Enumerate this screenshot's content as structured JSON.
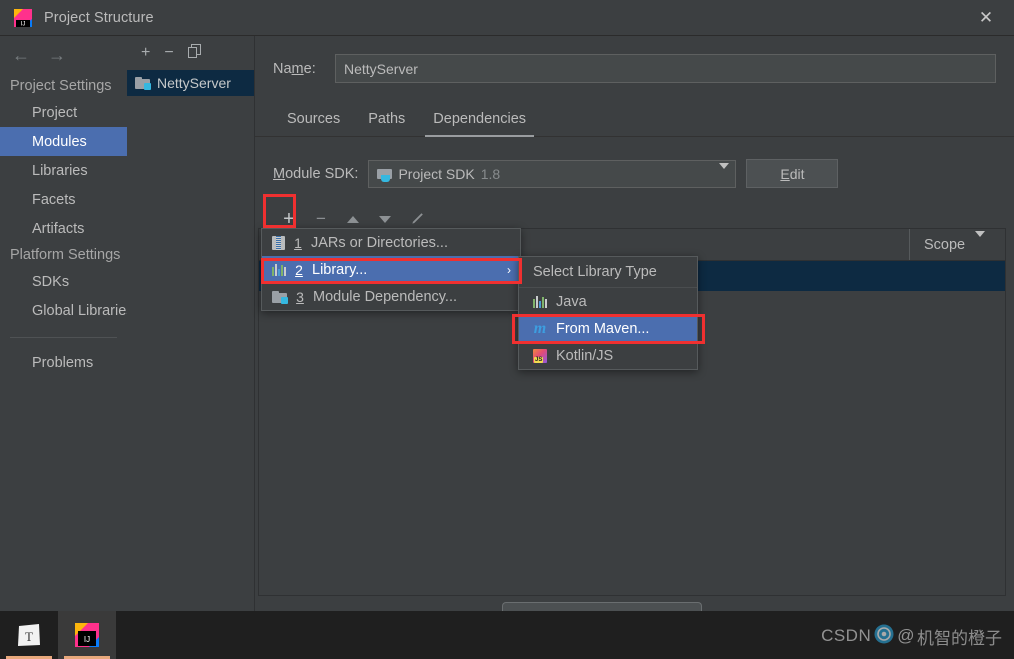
{
  "window": {
    "title": "Project Structure",
    "close_label": "✕",
    "app_icon": "intellij-idea-icon"
  },
  "leftnav": {
    "back_icon": "←",
    "forward_icon": "→",
    "groups": [
      {
        "label": "Project Settings",
        "items": [
          {
            "label": "Project",
            "selected": false
          },
          {
            "label": "Modules",
            "selected": true
          },
          {
            "label": "Libraries",
            "selected": false
          },
          {
            "label": "Facets",
            "selected": false
          },
          {
            "label": "Artifacts",
            "selected": false
          }
        ]
      },
      {
        "label": "Platform Settings",
        "items": [
          {
            "label": "SDKs",
            "selected": false
          },
          {
            "label": "Global Libraries",
            "selected": false
          }
        ]
      }
    ],
    "problems_label": "Problems"
  },
  "modules_panel": {
    "toolbar": {
      "add_icon": "+",
      "remove_icon": "−",
      "copy_icon": "copy-icon"
    },
    "modules": [
      {
        "name": "NettyServer",
        "selected": true
      }
    ]
  },
  "detail": {
    "name_label_pre": "Na",
    "name_label_mid": "m",
    "name_label_post": "e:",
    "name_value": "NettyServer",
    "tabs": [
      {
        "label": "Sources",
        "active": false
      },
      {
        "label": "Paths",
        "active": false
      },
      {
        "label": "Dependencies",
        "active": true
      }
    ],
    "sdk_label_pre": "M",
    "sdk_label_post": "odule SDK:",
    "sdk_value": "Project SDK",
    "sdk_version": "1.8",
    "sdk_dropdown_icon": "chevron-down-icon",
    "edit_button_pre": "E",
    "edit_button_post": "dit",
    "dep_toolbar": {
      "add_icon": "+",
      "remove_icon": "−",
      "move_up_icon": "arrow-up-icon",
      "move_down_icon": "arrow-down-icon",
      "edit_icon": "pencil-icon"
    },
    "table": {
      "scope_header": "Scope",
      "scope_sort_icon": "chevron-down-icon"
    }
  },
  "add_menu": {
    "items": [
      {
        "num": "1",
        "label": "JARs or Directories...",
        "icon": "jar-icon",
        "selected": false,
        "submenu": false
      },
      {
        "num": "2",
        "label": "Library...",
        "icon": "library-icon",
        "selected": true,
        "submenu": true,
        "submenu_arrow": "›"
      },
      {
        "num": "3",
        "label": "Module Dependency...",
        "icon": "module-icon",
        "selected": false,
        "submenu": false
      }
    ]
  },
  "library_type_submenu": {
    "title": "Select Library Type",
    "items": [
      {
        "label": "Java",
        "icon": "java-library-icon",
        "selected": false
      },
      {
        "label": "From Maven...",
        "icon": "maven-icon",
        "selected": true
      },
      {
        "label": "Kotlin/JS",
        "icon": "kotlin-js-icon",
        "selected": false
      }
    ]
  },
  "taskbar": {
    "items": [
      {
        "name": "typora-app",
        "glyph": "T"
      },
      {
        "name": "intellij-idea-app",
        "glyph": "IJ"
      }
    ]
  },
  "watermark": {
    "prefix": "CSDN",
    "at": "@",
    "author": "机智的橙子"
  },
  "colors": {
    "accent_selection": "#4b6eaf",
    "row_selection": "#0d2a42",
    "panel_bg": "#3c3f41",
    "annotation_red": "#f03030",
    "taskbar_bg": "#1f1f1f"
  }
}
